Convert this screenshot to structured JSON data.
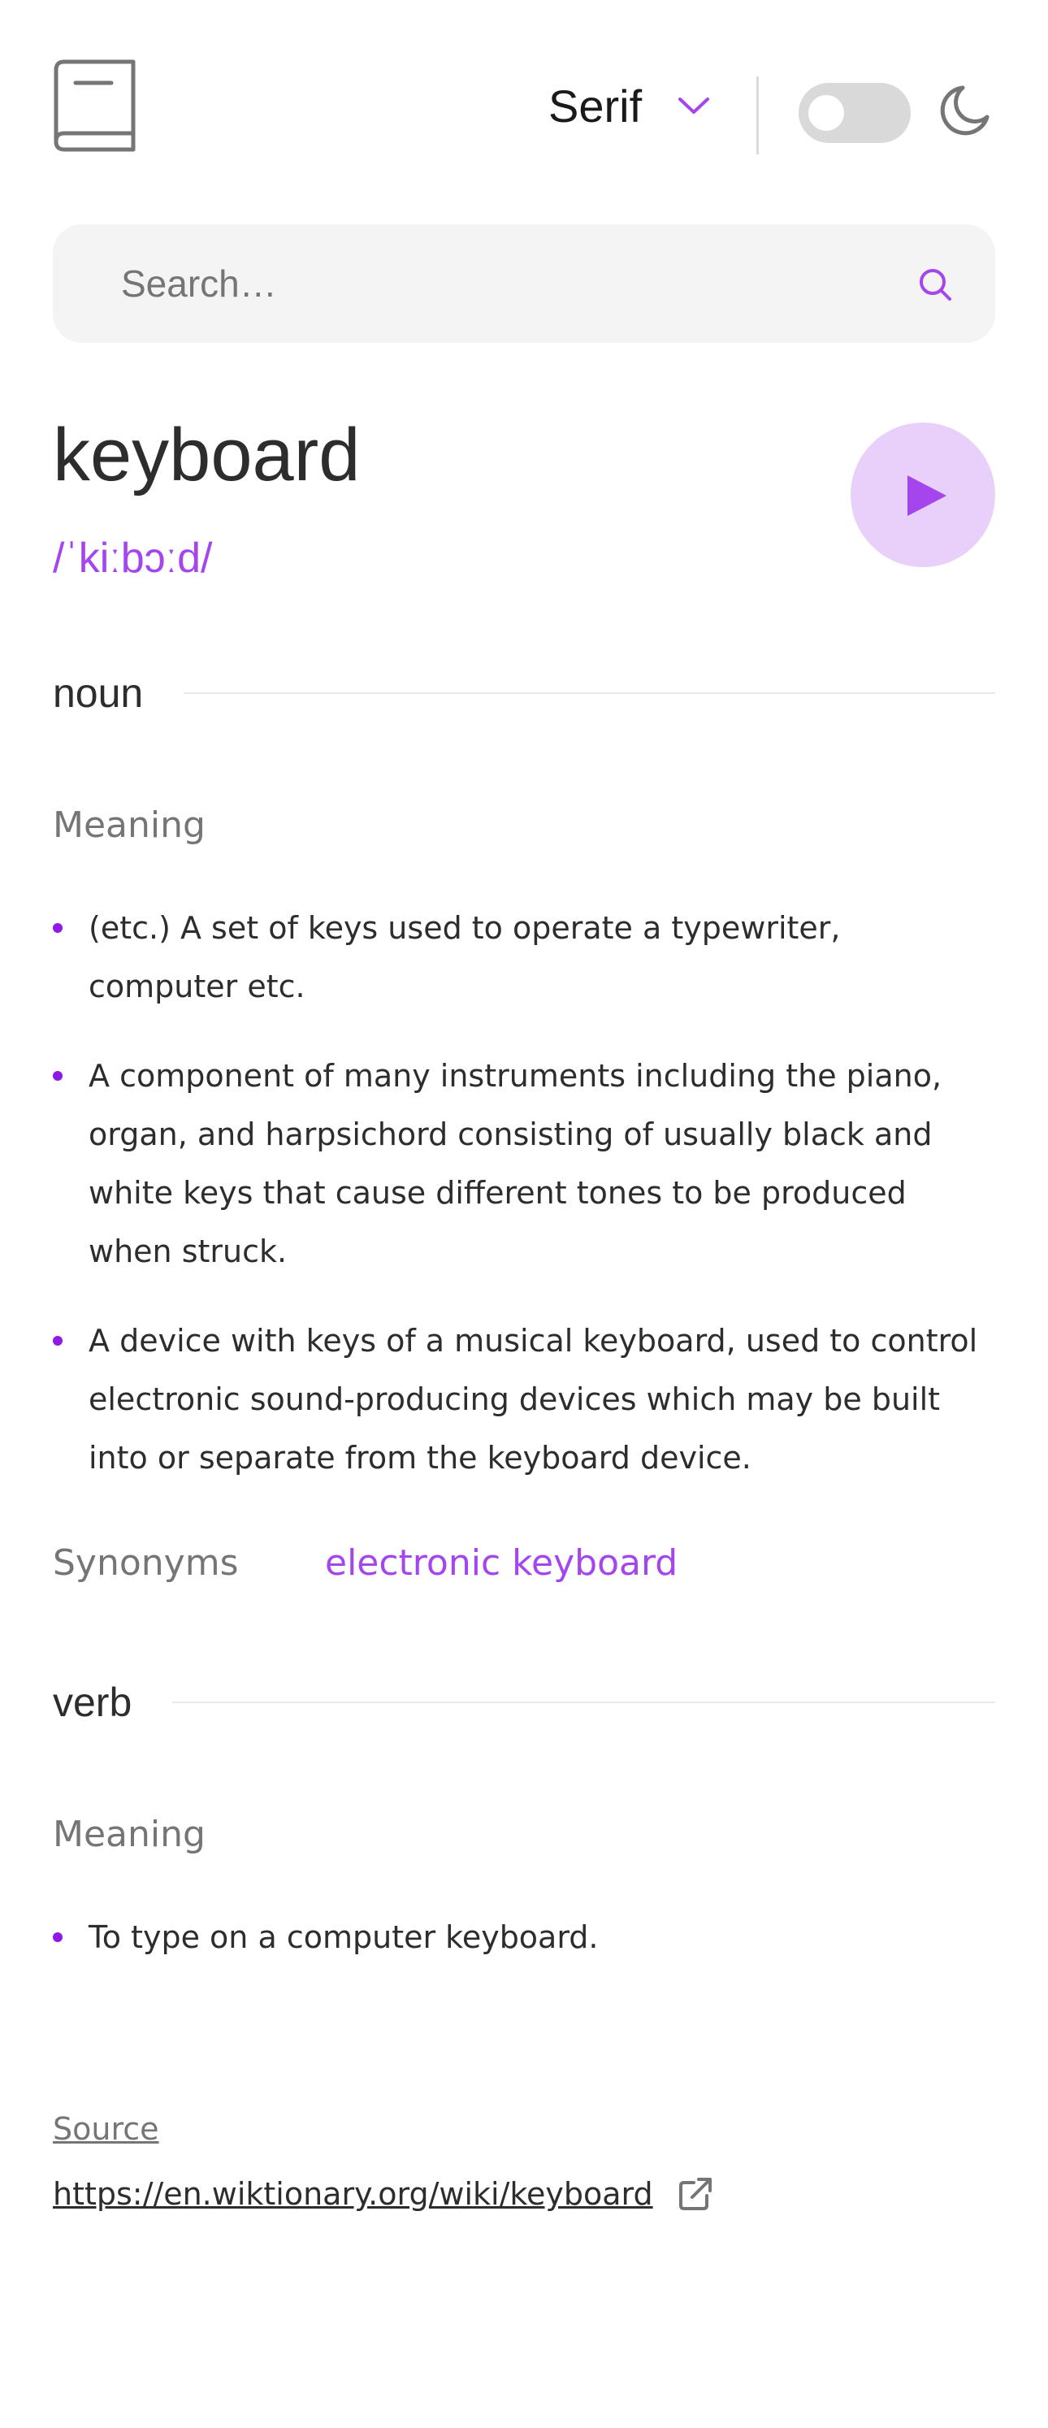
{
  "header": {
    "font_label": "Serif",
    "theme_toggle_on": false
  },
  "search": {
    "placeholder": "Search…",
    "value": ""
  },
  "word": {
    "text": "keyboard",
    "phonetic": "/ˈkiːbɔːd/"
  },
  "sections": {
    "noun": {
      "pos": "noun",
      "meaning_label": "Meaning",
      "meanings": [
        "(etc.) A set of keys used to operate a typewriter, computer etc.",
        "A component of many instruments including the piano, organ, and harpsichord consisting of usually black and white keys that cause different tones to be produced when struck.",
        "A device with keys of a musical keyboard, used to control electronic sound-producing devices which may be built into or separate from the keyboard device."
      ],
      "synonyms_label": "Synonyms",
      "synonyms": "electronic keyboard"
    },
    "verb": {
      "pos": "verb",
      "meaning_label": "Meaning",
      "meanings": [
        "To type on a computer keyboard."
      ]
    }
  },
  "footer": {
    "source_label": "Source",
    "source_url": "https://en.wiktionary.org/wiki/keyboard"
  },
  "colors": {
    "accent": "#a445ed",
    "bullet": "#8f19e8",
    "play_bg": "#e9d0fa",
    "muted": "#757575",
    "search_bg": "#f4f4f4"
  },
  "icons": [
    "book-icon",
    "chevron-down-icon",
    "moon-icon",
    "search-icon",
    "play-icon",
    "external-link-icon"
  ]
}
